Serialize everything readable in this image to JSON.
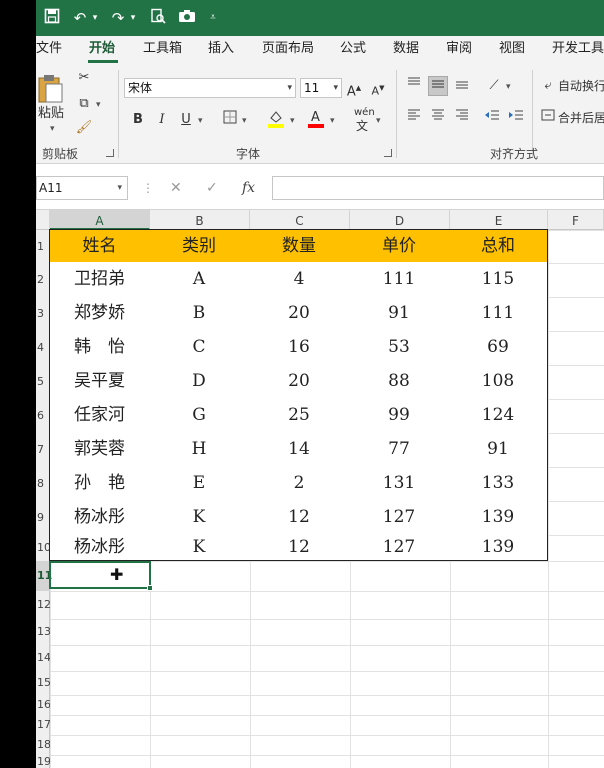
{
  "ribbon_tabs": [
    "文件",
    "开始",
    "工具箱",
    "插入",
    "页面布局",
    "公式",
    "数据",
    "审阅",
    "视图",
    "开发工具"
  ],
  "active_tab": "开始",
  "clipboard": {
    "paste_label": "粘贴",
    "group_label": "剪贴板"
  },
  "font": {
    "name": "宋体",
    "size": "11",
    "group_label": "字体",
    "bold": "B",
    "italic": "I",
    "underline": "U",
    "wen_label": "wén"
  },
  "alignment": {
    "group_label": "对齐方式",
    "wrap_label": "自动换行",
    "merge_label": "合并后居"
  },
  "formula_bar": {
    "name_box": "A11",
    "fx": "fx",
    "formula": ""
  },
  "columns": [
    "A",
    "B",
    "C",
    "D",
    "E",
    "F"
  ],
  "active_column": "A",
  "rows": [
    "1",
    "2",
    "3",
    "4",
    "5",
    "6",
    "7",
    "8",
    "9",
    "10",
    "11",
    "12",
    "13",
    "14",
    "15",
    "16",
    "17",
    "18",
    "19"
  ],
  "active_row": "11",
  "table": {
    "headers": [
      "姓名",
      "类别",
      "数量",
      "单价",
      "总和"
    ],
    "rows": [
      [
        "卫招弟",
        "A",
        "4",
        "111",
        "115"
      ],
      [
        "郑梦娇",
        "B",
        "20",
        "91",
        "111"
      ],
      [
        "韩　怡",
        "C",
        "16",
        "53",
        "69"
      ],
      [
        "吴平夏",
        "D",
        "20",
        "88",
        "108"
      ],
      [
        "任家河",
        "G",
        "25",
        "99",
        "124"
      ],
      [
        "郭芙蓉",
        "H",
        "14",
        "77",
        "91"
      ],
      [
        "孙　艳",
        "E",
        "2",
        "131",
        "133"
      ],
      [
        "杨冰彤",
        "K",
        "12",
        "127",
        "139"
      ],
      [
        "杨冰彤",
        "K",
        "12",
        "127",
        "139"
      ]
    ]
  },
  "colors": {
    "brand": "#217346",
    "header_fill": "#ffc000"
  }
}
